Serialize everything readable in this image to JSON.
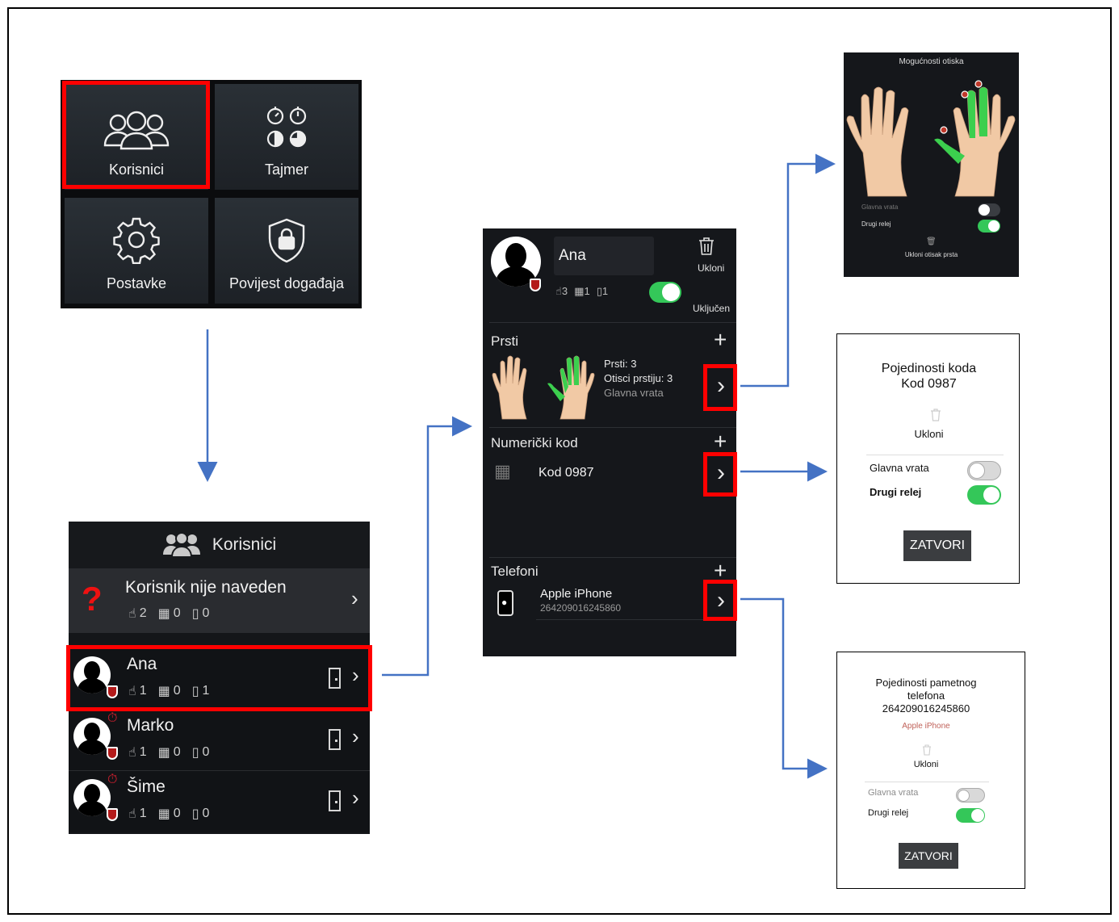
{
  "main_menu": {
    "users": "Korisnici",
    "timer": "Tajmer",
    "settings": "Postavke",
    "event_history": "Povijest događaja"
  },
  "users_screen": {
    "title": "Korisnici",
    "unknown_user": {
      "name": "Korisnik nije naveden",
      "fingers": "2",
      "codes": "0",
      "phones": "0",
      "mark": "?"
    },
    "rows": [
      {
        "name": "Ana",
        "fingers": "1",
        "codes": "0",
        "phones": "1"
      },
      {
        "name": "Marko",
        "fingers": "1",
        "codes": "0",
        "phones": "0"
      },
      {
        "name": "Šime",
        "fingers": "1",
        "codes": "0",
        "phones": "0"
      }
    ]
  },
  "user_detail": {
    "name": "Ana",
    "remove_label": "Ukloni",
    "enabled_label": "Uključen",
    "fingers_count": "3",
    "codes_count": "1",
    "phones_count": "1",
    "fingers_section": {
      "title": "Prsti",
      "fingers_line": "Prsti: 3",
      "prints_line": "Otisci prstiju: 3",
      "relay_line": "Glavna vrata"
    },
    "code_section": {
      "title": "Numerički kod",
      "code_name": "Kod 0987"
    },
    "phones_section": {
      "title": "Telefoni",
      "phone_name": "Apple iPhone",
      "phone_id": "264209016245860"
    }
  },
  "fingerprint_options": {
    "title": "Mogućnosti otiska",
    "relay_main": "Glavna vrata",
    "relay_second": "Drugi relej",
    "remove_label": "Ukloni otisak prsta"
  },
  "code_dialog": {
    "title_line1": "Pojedinosti koda",
    "title_line2": "Kod 0987",
    "remove_label": "Ukloni",
    "relay_main": "Glavna vrata",
    "relay_second": "Drugi relej",
    "close_label": "ZATVORI"
  },
  "phone_dialog": {
    "title_line1": "Pojedinosti pametnog",
    "title_line2": "telefona",
    "title_line3": "264209016245860",
    "subtitle": "Apple iPhone",
    "remove_label": "Ukloni",
    "relay_main": "Glavna vrata",
    "relay_second": "Drugi relej",
    "close_label": "ZATVORI"
  },
  "colors": {
    "highlight": "#ff0000",
    "connector": "#4472c4",
    "toggle_on": "#34c759",
    "finger_green": "#3ccf4e"
  }
}
